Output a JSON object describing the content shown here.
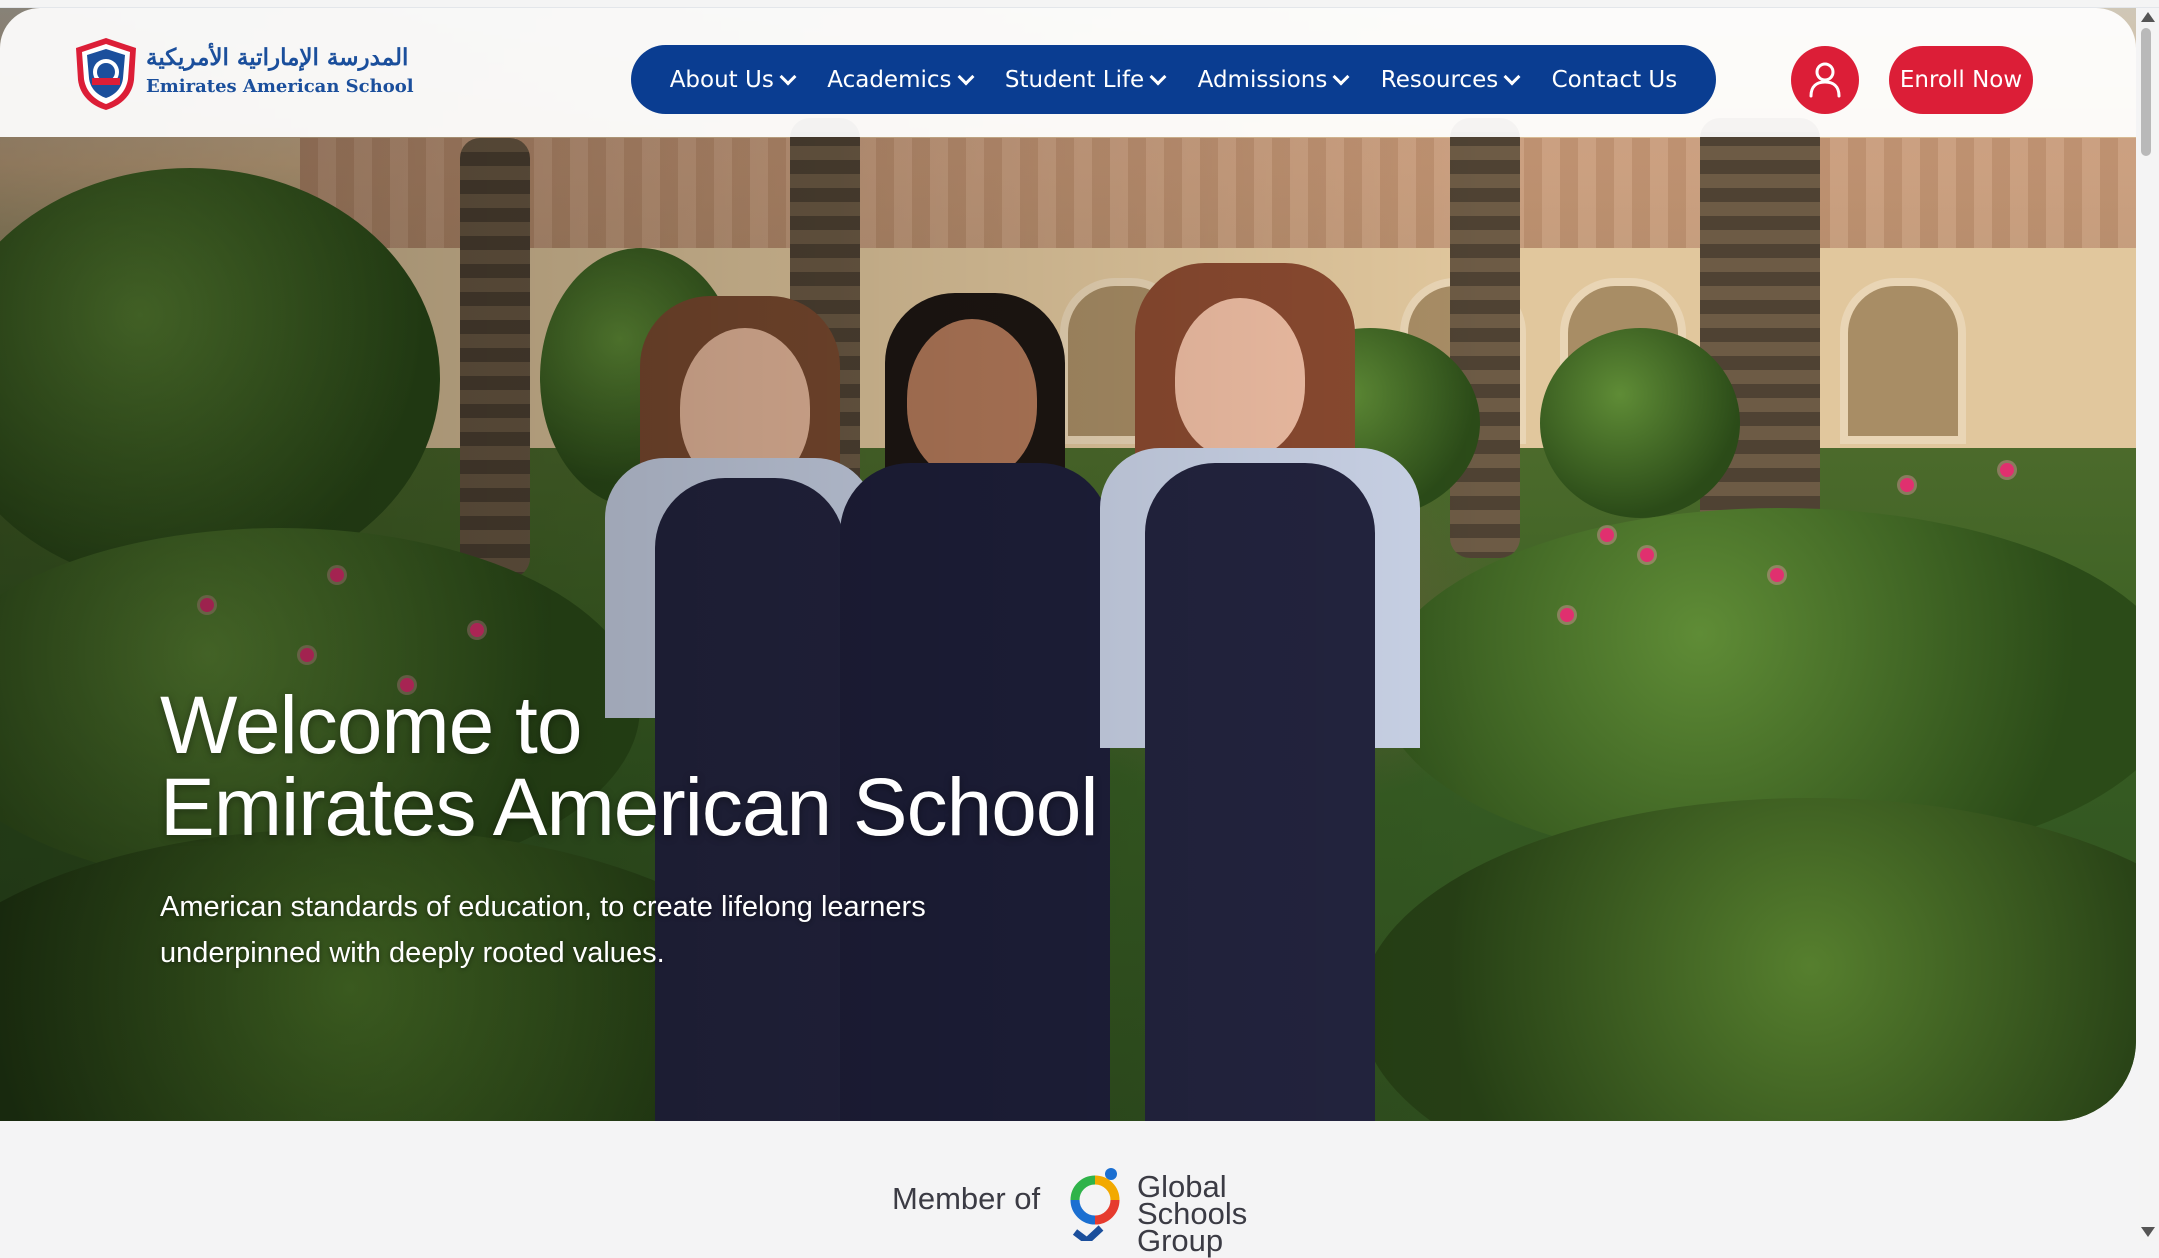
{
  "header": {
    "logo_arabic": "المدرسة الإماراتية الأمريكية",
    "logo_english": "Emirates American School",
    "logo_icon": "school-crest-icon"
  },
  "nav": {
    "items": [
      {
        "label": "About Us",
        "has_dropdown": true
      },
      {
        "label": "Academics",
        "has_dropdown": true
      },
      {
        "label": "Student Life",
        "has_dropdown": true
      },
      {
        "label": "Admissions",
        "has_dropdown": true
      },
      {
        "label": "Resources",
        "has_dropdown": true
      },
      {
        "label": "Contact Us",
        "has_dropdown": false
      }
    ],
    "background_color": "#0a3d91"
  },
  "actions": {
    "user_icon": "user-icon",
    "enroll_label": "Enroll Now",
    "accent_color": "#dc1e37"
  },
  "hero": {
    "title_line1": "Welcome to",
    "title_line2": "Emirates American School",
    "subtitle": "American standards of education, to create lifelong learners underpinned with deeply rooted values."
  },
  "member": {
    "label": "Member of",
    "org_line1": "Global",
    "org_line2": "Schools",
    "org_line3": "Group"
  }
}
